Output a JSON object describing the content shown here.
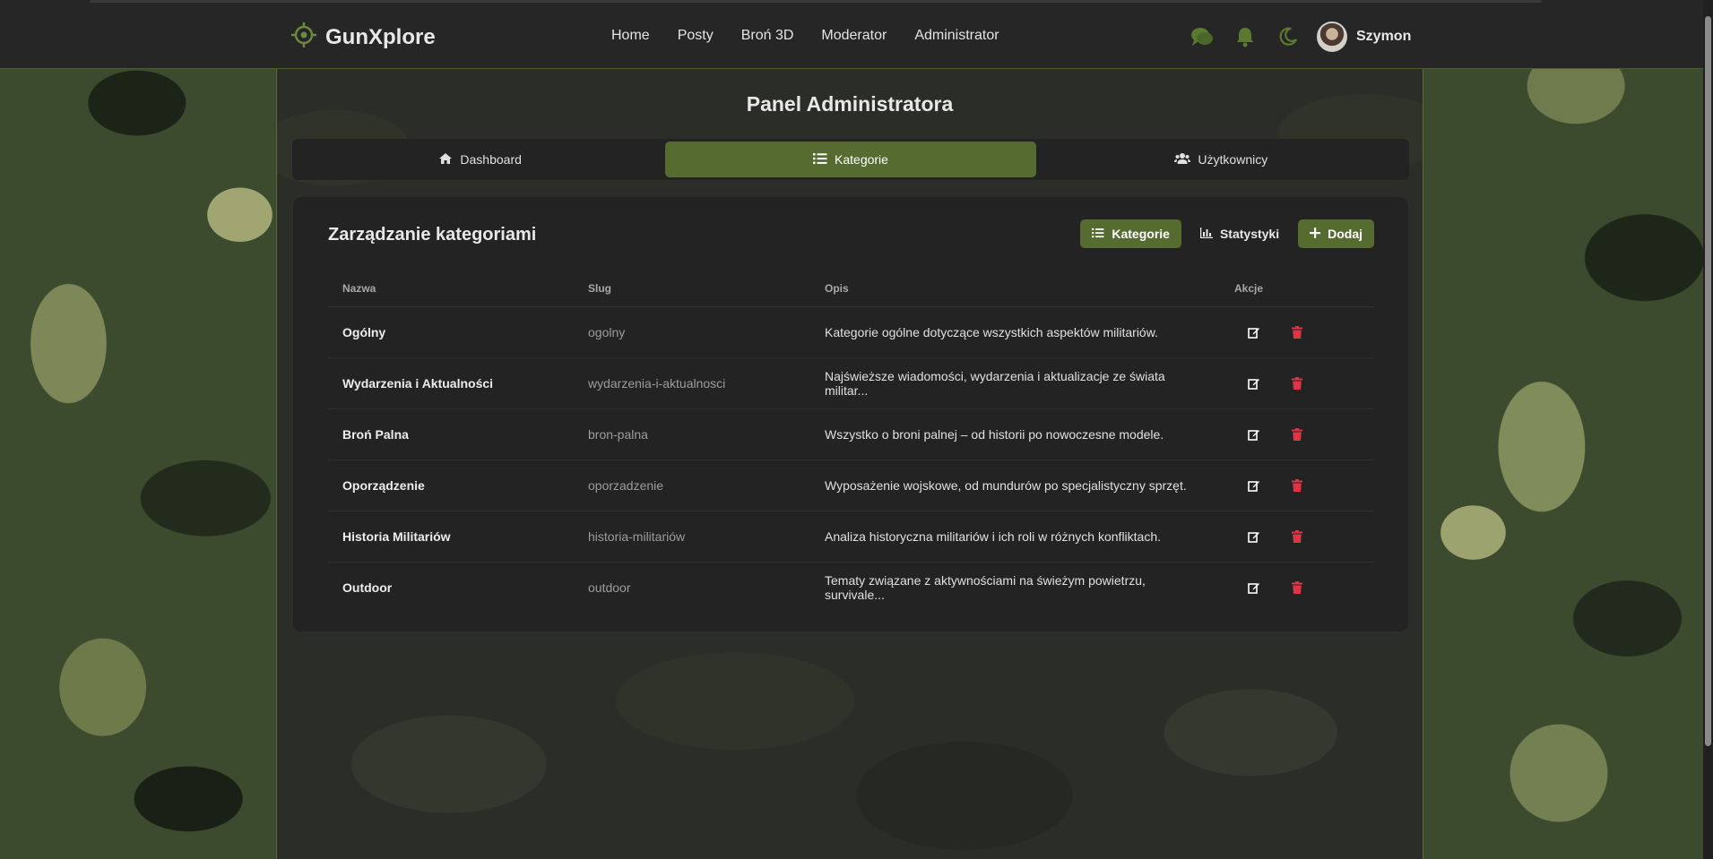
{
  "brand": {
    "name": "GunXplore"
  },
  "nav": {
    "items": [
      "Home",
      "Posty",
      "Broń 3D",
      "Moderator",
      "Administrator"
    ]
  },
  "user": {
    "name": "Szymon"
  },
  "colors": {
    "accent": "#556b2f",
    "danger": "#dc3545",
    "icon_green": "#5b7a30"
  },
  "page": {
    "title": "Panel Administratora"
  },
  "tabs": [
    {
      "label": "Dashboard",
      "icon": "home-icon"
    },
    {
      "label": "Kategorie",
      "icon": "list-icon",
      "active": true
    },
    {
      "label": "Użytkownicy",
      "icon": "users-icon"
    }
  ],
  "card": {
    "title": "Zarządzanie kategoriami",
    "buttons": {
      "categories": "Kategorie",
      "stats": "Statystyki",
      "add": "Dodaj"
    }
  },
  "table": {
    "headers": {
      "name": "Nazwa",
      "slug": "Slug",
      "desc": "Opis",
      "actions": "Akcje"
    },
    "rows": [
      {
        "name": "Ogólny",
        "slug": "ogolny",
        "desc": "Kategorie ogólne dotyczące wszystkich aspektów militariów."
      },
      {
        "name": "Wydarzenia i Aktualności",
        "slug": "wydarzenia-i-aktualnosci",
        "desc": "Najświeższe wiadomości, wydarzenia i aktualizacje ze świata militar..."
      },
      {
        "name": "Broń Palna",
        "slug": "bron-palna",
        "desc": "Wszystko o broni palnej – od historii po nowoczesne modele."
      },
      {
        "name": "Oporządzenie",
        "slug": "oporzadzenie",
        "desc": "Wyposażenie wojskowe, od mundurów po specjalistyczny sprzęt."
      },
      {
        "name": "Historia Militariów",
        "slug": "historia-militariów",
        "desc": "Analiza historyczna militariów i ich roli w różnych konfliktach."
      },
      {
        "name": "Outdoor",
        "slug": "outdoor",
        "desc": "Tematy związane z aktywnościami na świeżym powietrzu, survivale..."
      }
    ]
  }
}
